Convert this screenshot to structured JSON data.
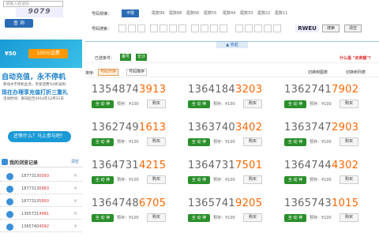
{
  "left": {
    "captcha_placeholder": "请输入验证码",
    "captcha_value": "9079",
    "query_button": "查 询",
    "promo1_badge": "¥50",
    "promo1_text": "100元话费",
    "promo2_title": "自动充值，永不停机",
    "promo2_line1": "移动水不停机业务，享受话费%5折返利",
    "promo2_line2": "现在办理享充值打折三重礼",
    "promo2_line3": "活动时间：即日起至2014年12月31日",
    "promo2_button": "还等什么？马上参与吧！",
    "history_title": "我的浏览记录",
    "history_clear": "清空",
    "history": [
      {
        "prefix": "1877313",
        "suffix": "0093"
      },
      {
        "prefix": "1877313",
        "suffix": "0983"
      },
      {
        "prefix": "1877313",
        "suffix": "5950"
      },
      {
        "prefix": "1365731",
        "suffix": "4981"
      },
      {
        "prefix": "1365740",
        "suffix": "4092"
      }
    ]
  },
  "filters": {
    "rule_label": "号码规律：",
    "rule_options": [
      "不限",
      "尾数99",
      "尾数88",
      "尾数66",
      "尾数55",
      "尾数44",
      "尾数33",
      "尾数22",
      "尾数11"
    ],
    "search_label": "号码搜索：",
    "captcha_text": "RWEU",
    "search_button": "搜索",
    "clear_button": "清空",
    "collapse": "▲ 收起"
  },
  "selected": {
    "label": "已选条件：",
    "tags": [
      "番号",
      "长沙"
    ],
    "help_link": "什么是 \"买卖靓\"？"
  },
  "sort": {
    "label": "排序:",
    "options": [
      "号码升序",
      "号码降序"
    ],
    "view_list": "切换到图表",
    "view_grid": "切换到列表"
  },
  "cards": [
    {
      "prefix": "1354874",
      "suffix": "3913",
      "price": "预存：¥100",
      "buy": "购买"
    },
    {
      "prefix": "1364184",
      "suffix": "3203",
      "price": "预存：¥100",
      "buy": "购买"
    },
    {
      "prefix": "1362741",
      "suffix": "7902",
      "price": "预存：¥100",
      "buy": "购买"
    },
    {
      "prefix": "1362749",
      "suffix": "1613",
      "price": "预存：¥100",
      "buy": "购买"
    },
    {
      "prefix": "1363740",
      "suffix": "3402",
      "price": "预存：¥100",
      "buy": "购买"
    },
    {
      "prefix": "1363747",
      "suffix": "2903",
      "price": "预存：¥100",
      "buy": "购买"
    },
    {
      "prefix": "1364731",
      "suffix": "4215",
      "price": "预存：¥100",
      "buy": "购买"
    },
    {
      "prefix": "1364731",
      "suffix": "7501",
      "price": "预存：¥100",
      "buy": "购买"
    },
    {
      "prefix": "1364744",
      "suffix": "4302",
      "price": "预存：¥100",
      "buy": "购买"
    },
    {
      "prefix": "1364748",
      "suffix": "6705",
      "price": "预存：¥100",
      "buy": "购买"
    },
    {
      "prefix": "1365741",
      "suffix": "9205",
      "price": "预存：¥100",
      "buy": "购买"
    },
    {
      "prefix": "1365743",
      "suffix": "1015",
      "price": "预存：¥100",
      "buy": "购买"
    }
  ],
  "card_tag": "全 动 神",
  "colors": {
    "accent": "#ff6600",
    "brand": "#2a6bb5",
    "tag_green": "#2a8f2a",
    "link_red": "#e03030"
  }
}
